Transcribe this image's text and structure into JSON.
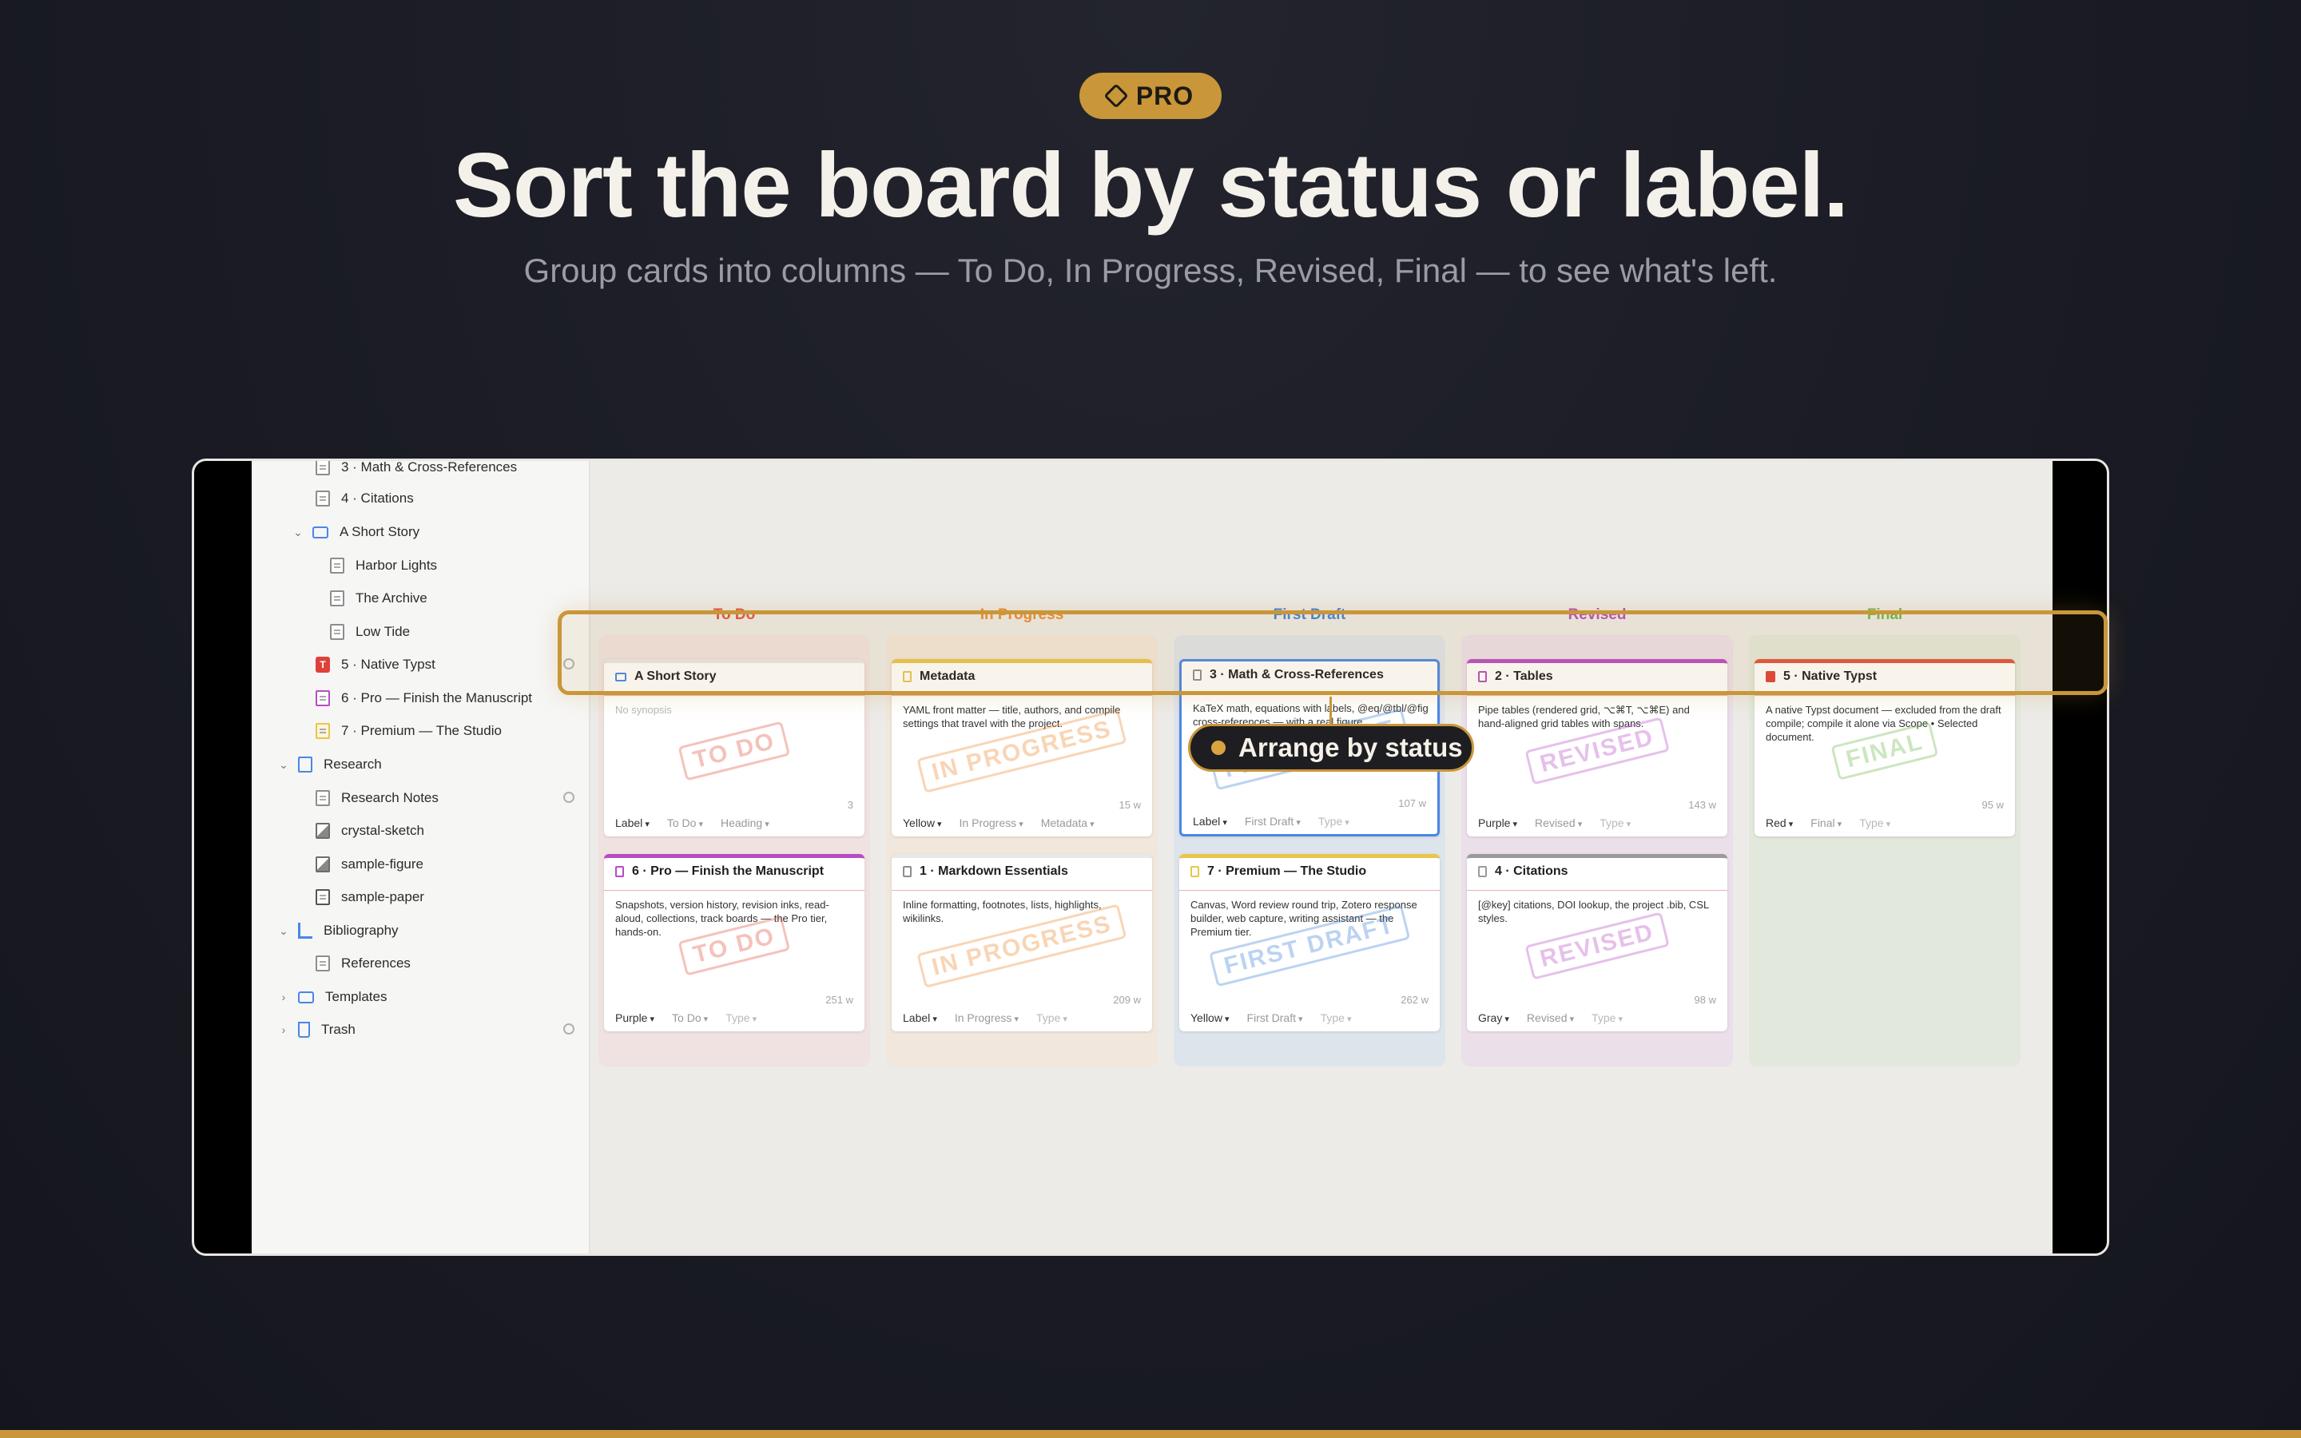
{
  "hero": {
    "badge": "PRO",
    "headline": "Sort the board by status or label.",
    "subhead": "Group cards into columns — To Do, In Progress, Revised, Final — to see what's left."
  },
  "sidebar": {
    "items": [
      {
        "label": "3 · Math & Cross-References",
        "icon": "doc-icon"
      },
      {
        "label": "4 · Citations",
        "icon": "doc-icon"
      },
      {
        "label": "A Short Story",
        "icon": "folder-icon"
      },
      {
        "label": "Harbor Lights",
        "icon": "doc-icon"
      },
      {
        "label": "The Archive",
        "icon": "doc-icon"
      },
      {
        "label": "Low Tide",
        "icon": "doc-icon"
      },
      {
        "label": "5 · Native Typst",
        "icon": "typst-icon"
      },
      {
        "label": "6 · Pro — Finish the Manuscript",
        "icon": "doc-icon"
      },
      {
        "label": "7 · Premium — The Studio",
        "icon": "doc-icon"
      },
      {
        "label": "Research",
        "icon": "archive-icon"
      },
      {
        "label": "Research Notes",
        "icon": "doc-icon"
      },
      {
        "label": "crystal-sketch",
        "icon": "image-icon"
      },
      {
        "label": "sample-figure",
        "icon": "image-icon"
      },
      {
        "label": "sample-paper",
        "icon": "pdf-icon"
      },
      {
        "label": "Bibliography",
        "icon": "bibliography-icon"
      },
      {
        "label": "References",
        "icon": "doc-icon"
      },
      {
        "label": "Templates",
        "icon": "templates-folder-icon"
      },
      {
        "label": "Trash",
        "icon": "trash-icon"
      }
    ]
  },
  "board": {
    "columns": [
      {
        "title": "To Do",
        "color": "#e0533f",
        "bg": "#f0e2e0"
      },
      {
        "title": "In Progress",
        "color": "#ec8a2f",
        "bg": "#f1e7dc"
      },
      {
        "title": "First Draft",
        "color": "#3f83dc",
        "bg": "#dee4ec"
      },
      {
        "title": "Revised",
        "color": "#b84cc4",
        "bg": "#ebdfea"
      },
      {
        "title": "Final",
        "color": "#6fb84c",
        "bg": "#e2e8dc"
      }
    ],
    "cards": [
      {
        "title": "A Short Story",
        "synopsis": "No synopsis",
        "stamp": "TO DO",
        "words": "3",
        "label": "Label",
        "status": "To Do",
        "type": "Heading",
        "accent": "#e8e8e8"
      },
      {
        "title": "6 · Pro — Finish the Manuscript",
        "synopsis": "Snapshots, version history, revision inks, read-aloud, collections, track boards — the Pro tier, hands-on.",
        "stamp": "TO DO",
        "words": "251 w",
        "label": "Purple",
        "status": "To Do",
        "type": "Type",
        "accent": "#b84cc4"
      },
      {
        "title": "Metadata",
        "synopsis": "YAML front matter — title, authors, and compile settings that travel with the project.",
        "stamp": "IN PROGRESS",
        "words": "15 w",
        "label": "Yellow",
        "status": "In Progress",
        "type": "Metadata",
        "accent": "#e9c54a"
      },
      {
        "title": "1 · Markdown Essentials",
        "synopsis": "Inline formatting, footnotes, lists, highlights, wikilinks.",
        "stamp": "IN PROGRESS",
        "words": "209 w",
        "label": "Label",
        "status": "In Progress",
        "type": "Type",
        "accent": "#e8e8e8"
      },
      {
        "title": "3 · Math & Cross-References",
        "synopsis": "KaTeX math, equations with labels, @eq/@tbl/@fig cross-references — with a real figure.",
        "stamp": "FIRST DRAFT",
        "words": "107 w",
        "label": "Label",
        "status": "First Draft",
        "type": "Type",
        "accent": "#e8e8e8"
      },
      {
        "title": "7 · Premium — The Studio",
        "synopsis": "Canvas, Word review round trip, Zotero response builder, web capture, writing assistant — the Premium tier.",
        "stamp": "FIRST DRAFT",
        "words": "262 w",
        "label": "Yellow",
        "status": "First Draft",
        "type": "Type",
        "accent": "#e9c54a"
      },
      {
        "title": "2 · Tables",
        "synopsis": "Pipe tables (rendered grid, ⌥⌘T, ⌥⌘E) and hand-aligned grid tables with spans.",
        "stamp": "REVISED",
        "words": "143 w",
        "label": "Purple",
        "status": "Revised",
        "type": "Type",
        "accent": "#b84cc4"
      },
      {
        "title": "4 · Citations",
        "synopsis": "[@key] citations, DOI lookup, the project .bib, CSL styles.",
        "stamp": "REVISED",
        "words": "98 w",
        "label": "Gray",
        "status": "Revised",
        "type": "Type",
        "accent": "#9a9a9a"
      },
      {
        "title": "5 · Native Typst",
        "synopsis": "A native Typst document — excluded from the draft compile; compile it alone via Scope • Selected document.",
        "stamp": "FINAL",
        "words": "95 w",
        "label": "Red",
        "status": "Final",
        "type": "Type",
        "accent": "#e0533f"
      }
    ]
  },
  "callout": {
    "label": "Arrange by status"
  },
  "colors": {
    "accent_gold": "#c9963a",
    "background": "#1a1b24"
  }
}
